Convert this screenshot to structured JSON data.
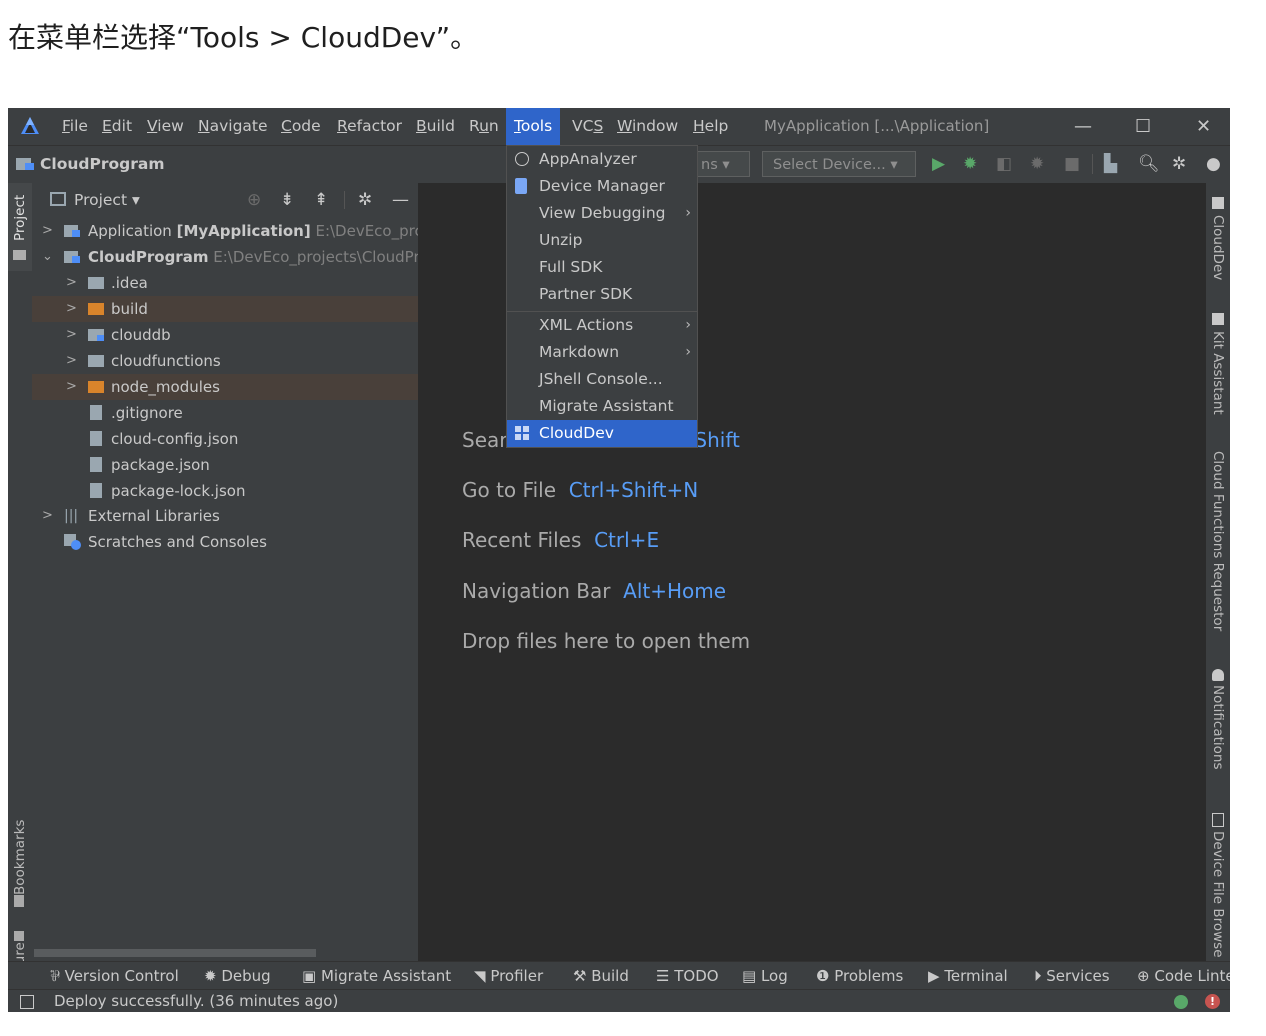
{
  "caption": "在菜单栏选择“Tools > CloudDev”。",
  "menubar": {
    "items": [
      {
        "label": "File",
        "ul": "F",
        "rest": "ile"
      },
      {
        "label": "Edit",
        "ul": "E",
        "rest": "dit"
      },
      {
        "label": "View",
        "ul": "V",
        "rest": "iew"
      },
      {
        "label": "Navigate",
        "ul": "N",
        "rest": "avigate"
      },
      {
        "label": "Code",
        "ul": "C",
        "rest": "ode"
      },
      {
        "label": "Refactor",
        "ul": "R",
        "rest": "efactor"
      },
      {
        "label": "Build",
        "ul": "B",
        "rest": "uild"
      },
      {
        "label": "Run",
        "pre": "R",
        "ul": "u",
        "rest": "n"
      },
      {
        "label": "Tools",
        "ul": "T",
        "rest": "ools"
      },
      {
        "label": "VCS",
        "pre": "VC",
        "ul": "S",
        "rest": ""
      },
      {
        "label": "Window",
        "ul": "W",
        "rest": "indow"
      },
      {
        "label": "Help",
        "ul": "H",
        "rest": "elp"
      }
    ],
    "window_title": "MyApplication [...\\Application]",
    "minimize": "—",
    "maximize": "☐",
    "close": "✕"
  },
  "toolbar": {
    "project_name": "CloudProgram",
    "config_combo": "ns ▾",
    "device_combo": "Select Device... ▾"
  },
  "left_strip": {
    "project": "Project",
    "bookmarks": "Bookmarks",
    "structure": "Structure"
  },
  "right_strip": {
    "clouddev": "CloudDev",
    "kit_assistant": "Kit Assistant",
    "cloud_functions": "Cloud Functions Requestor",
    "notifications": "Notifications",
    "device_file": "Device File Browse"
  },
  "project_panel": {
    "title": "Project ▾",
    "tree": [
      {
        "name": "Application",
        "bold": "[MyApplication]",
        "path": "E:\\DevEco_prc"
      },
      {
        "name": "CloudProgram",
        "path": "E:\\DevEco_projects\\CloudPr"
      },
      {
        "name": ".idea"
      },
      {
        "name": "build"
      },
      {
        "name": "clouddb"
      },
      {
        "name": "cloudfunctions"
      },
      {
        "name": "node_modules"
      },
      {
        "name": ".gitignore"
      },
      {
        "name": "cloud-config.json"
      },
      {
        "name": "package.json"
      },
      {
        "name": "package-lock.json"
      },
      {
        "name": "External Libraries"
      },
      {
        "name": "Scratches and Consoles"
      }
    ]
  },
  "editor_hints": [
    {
      "text": "Sear",
      "key": "ble Shift"
    },
    {
      "text": "Go to File",
      "key": "Ctrl+Shift+N"
    },
    {
      "text": "Recent Files",
      "key": "Ctrl+E"
    },
    {
      "text": "Navigation Bar",
      "key": "Alt+Home"
    },
    {
      "text": "Drop files here to open them",
      "key": ""
    }
  ],
  "tools_menu": [
    {
      "label": "AppAnalyzer"
    },
    {
      "label": "Device Manager"
    },
    {
      "label": "View Debugging",
      "submenu": "›"
    },
    {
      "label": "Unzip"
    },
    {
      "label": "Full SDK"
    },
    {
      "label": "Partner SDK"
    },
    {
      "label": "XML Actions",
      "submenu": "›"
    },
    {
      "label": "Markdown",
      "submenu": "›"
    },
    {
      "label": "JShell Console..."
    },
    {
      "label": "Migrate Assistant"
    },
    {
      "label": "CloudDev"
    }
  ],
  "bottom_bar": [
    "Version Control",
    "Debug",
    "Migrate Assistant",
    "Profiler",
    "Build",
    "TODO",
    "Log",
    "Problems",
    "Terminal",
    "Services",
    "Code Linte"
  ],
  "status": {
    "message": "Deploy successfully. (36 minutes ago)"
  },
  "colors": {
    "accent": "#2f65ca",
    "hint_key": "#589df6",
    "run_green": "#59a869"
  }
}
